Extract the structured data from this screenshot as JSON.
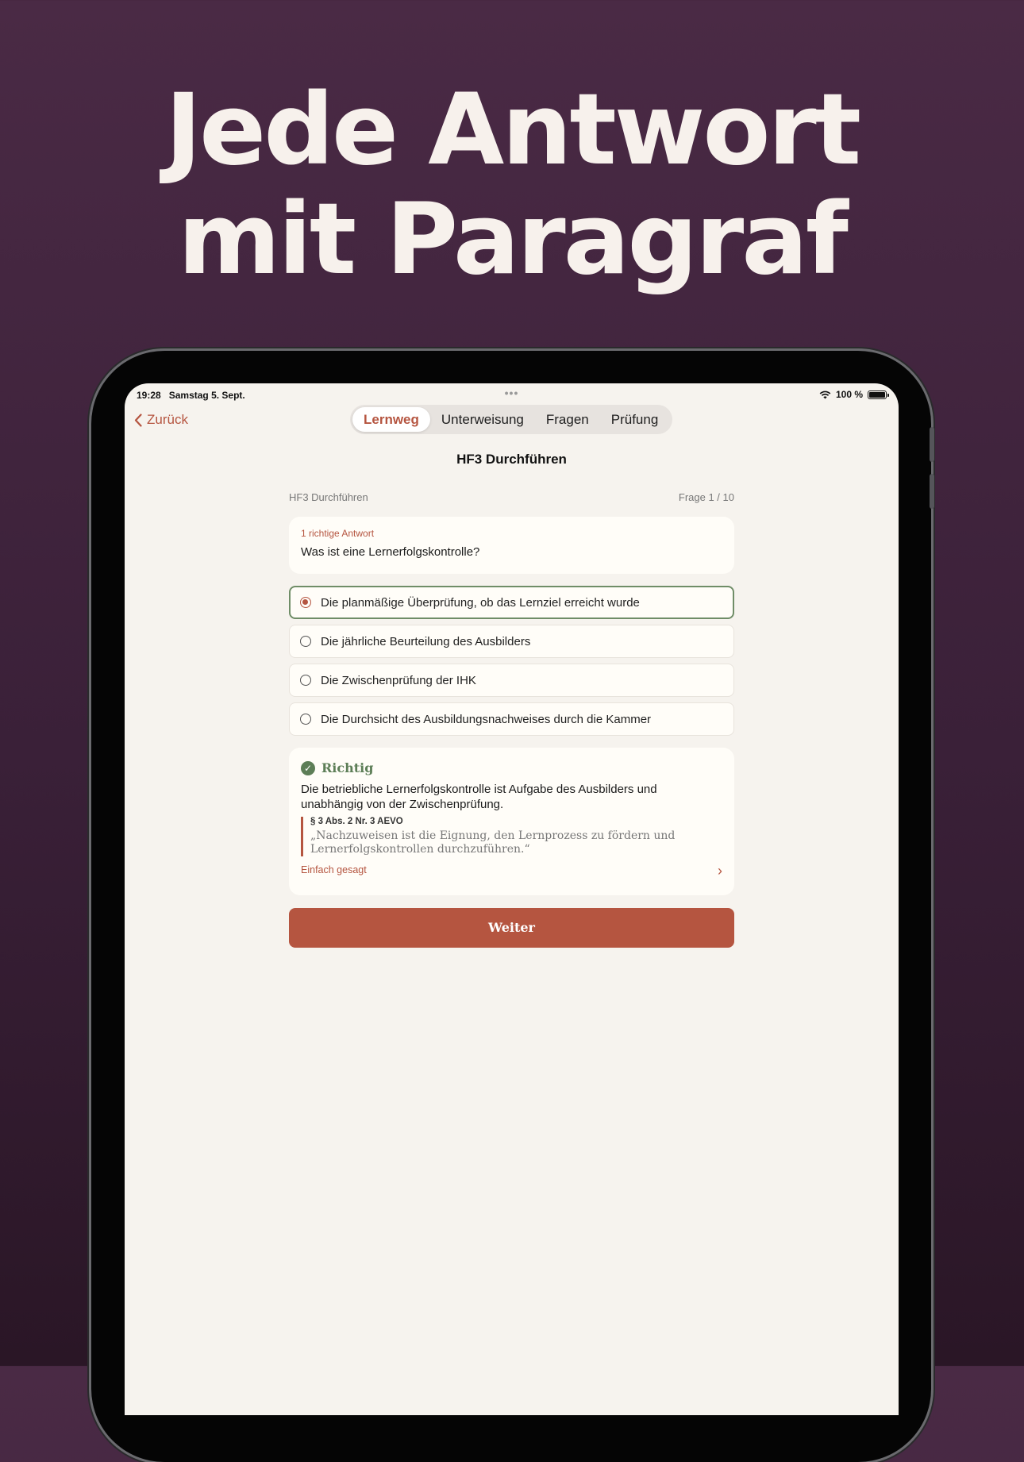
{
  "headline": {
    "line1": "Jede Antwort",
    "line2": "mit Paragraf"
  },
  "status": {
    "time": "19:28",
    "date": "Samstag 5. Sept.",
    "dots": "•••",
    "battery": "100 %"
  },
  "nav": {
    "back_label": "Zurück",
    "tabs": [
      {
        "label": "Lernweg",
        "active": true
      },
      {
        "label": "Unterweisung",
        "active": false
      },
      {
        "label": "Fragen",
        "active": false
      },
      {
        "label": "Prüfung",
        "active": false
      }
    ],
    "title": "HF3 Durchführen"
  },
  "quiz": {
    "section": "HF3 Durchführen",
    "progress": "Frage 1 / 10",
    "hint": "1 richtige Antwort",
    "question": "Was ist eine Lernerfolgskontrolle?",
    "options": [
      {
        "label": "Die planmäßige Überprüfung, ob das Lernziel erreicht wurde",
        "selected": true
      },
      {
        "label": "Die jährliche Beurteilung des Ausbilders",
        "selected": false
      },
      {
        "label": "Die Zwischenprüfung der IHK",
        "selected": false
      },
      {
        "label": "Die Durchsicht des Ausbildungsnachweises durch die Kammer",
        "selected": false
      }
    ]
  },
  "feedback": {
    "status": "Richtig",
    "explanation": "Die betriebliche Lernerfolgskontrolle ist Aufgabe des Ausbilders und unabhängig von der Zwischenprüfung.",
    "reference": "§ 3 Abs. 2 Nr. 3 AEVO",
    "citation": "„Nachzuweisen ist die Eignung, den Lernprozess zu fördern und Lernerfolgskontrollen durchzuführen.“",
    "simple_label": "Einfach gesagt"
  },
  "next_button": "Weiter",
  "colors": {
    "accent": "#b55540",
    "success": "#5d7e57",
    "background": "#4a2a45",
    "screen": "#f6f3ee"
  }
}
